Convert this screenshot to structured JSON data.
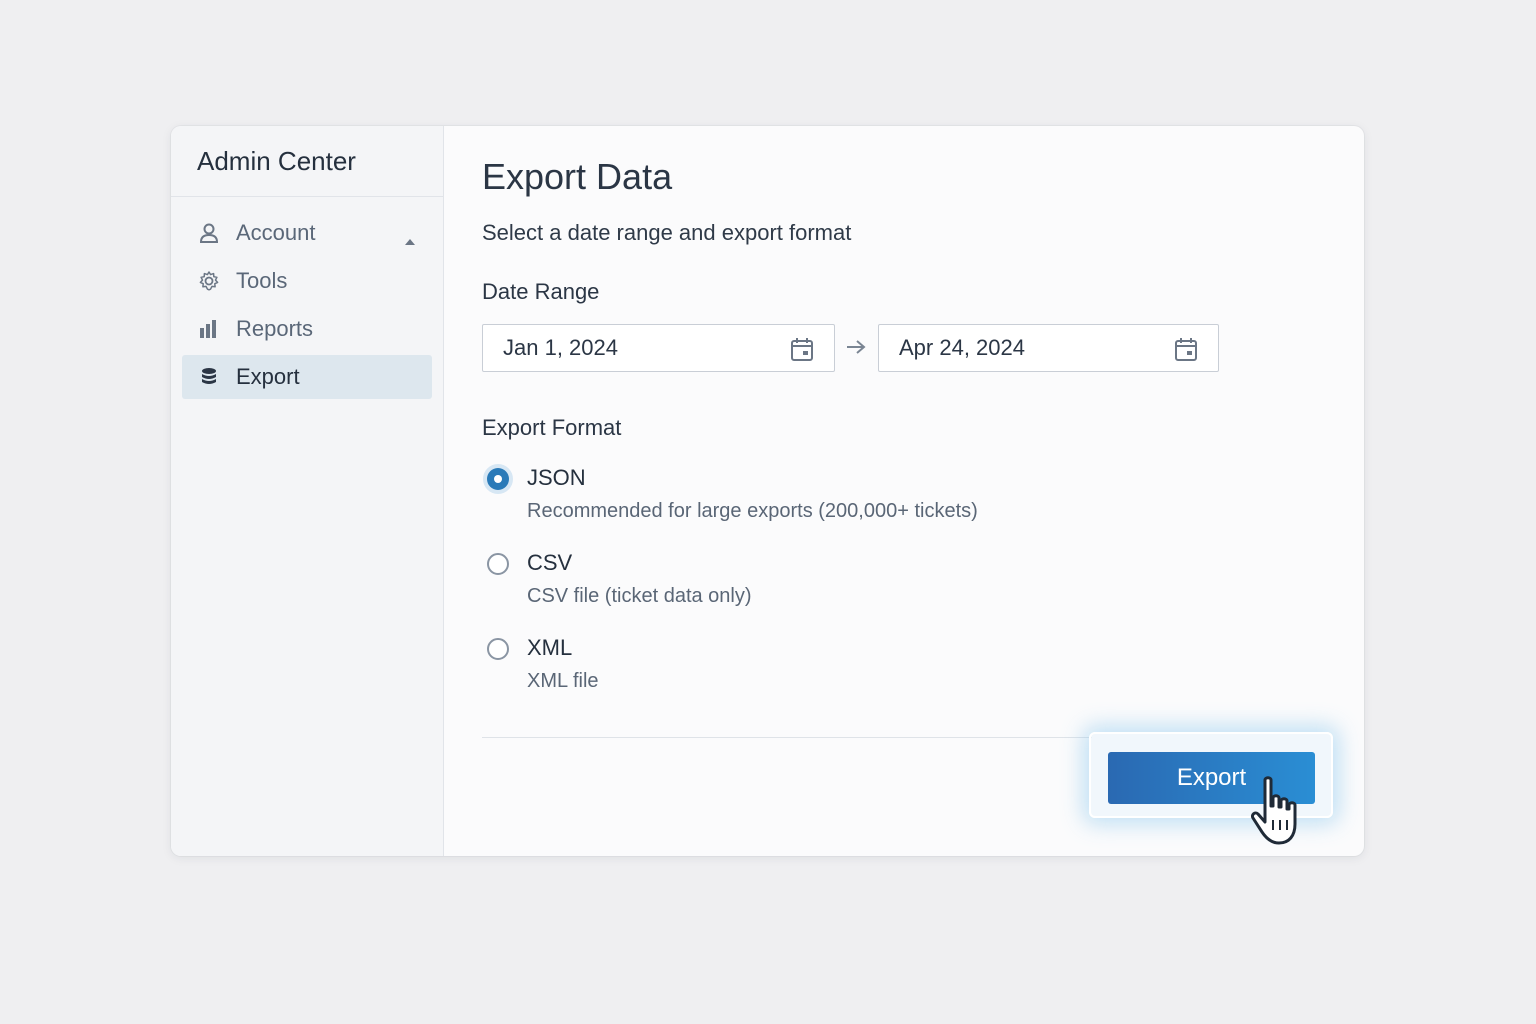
{
  "sidebar": {
    "title": "Admin Center",
    "items": [
      {
        "label": "Account",
        "icon": "user-icon"
      },
      {
        "label": "Tools",
        "icon": "gear-icon"
      },
      {
        "label": "Reports",
        "icon": "bar-chart-icon"
      },
      {
        "label": "Export",
        "icon": "database-icon",
        "active": true
      }
    ]
  },
  "main": {
    "title": "Export Data",
    "subtitle": "Select a date range and export format",
    "date_range": {
      "label": "Date Range",
      "start": "Jan 1, 2024",
      "end": "Apr 24, 2024"
    },
    "format": {
      "label": "Export Format",
      "options": [
        {
          "label": "JSON",
          "desc": "Recommended for large exports (200,000+ tickets)",
          "checked": true
        },
        {
          "label": "CSV",
          "desc": "CSV file (ticket data only)",
          "checked": false
        },
        {
          "label": "XML",
          "desc": "XML file",
          "checked": false
        }
      ]
    },
    "export_button": "Export"
  },
  "colors": {
    "accent": "#2a7ab8",
    "button_start": "#2a69b2",
    "button_end": "#2a8ed4",
    "active_nav": "#dde7ee"
  }
}
